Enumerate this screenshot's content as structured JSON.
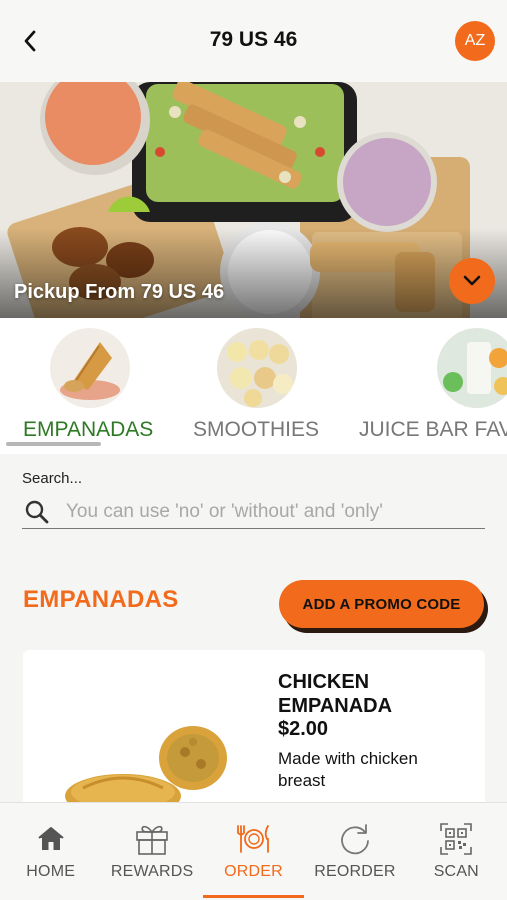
{
  "header": {
    "title": "79 US 46",
    "avatar_initials": "AZ"
  },
  "hero": {
    "pickup_text": "Pickup From 79 US 46"
  },
  "categories": [
    {
      "label": "EMPANADAS",
      "active": true
    },
    {
      "label": "SMOOTHIES",
      "active": false
    },
    {
      "label": "JUICE BAR FAV",
      "active": false
    }
  ],
  "search": {
    "caption": "Search...",
    "placeholder": "You can use 'no' or 'without' and 'only'",
    "value": ""
  },
  "section": {
    "title": "EMPANADAS",
    "promo_button": "ADD A PROMO CODE"
  },
  "product": {
    "name": "CHICKEN EMPANADA",
    "price": "$2.00",
    "description": "Made with chicken breast"
  },
  "bottom_nav": [
    {
      "label": "HOME",
      "icon": "home-icon",
      "active": false
    },
    {
      "label": "REWARDS",
      "icon": "gift-icon",
      "active": false
    },
    {
      "label": "ORDER",
      "icon": "utensils-icon",
      "active": true
    },
    {
      "label": "REORDER",
      "icon": "reorder-icon",
      "active": false
    },
    {
      "label": "SCAN",
      "icon": "qr-code-icon",
      "active": false
    }
  ],
  "colors": {
    "accent": "#f26a1b",
    "active_category": "#2e7a24"
  }
}
